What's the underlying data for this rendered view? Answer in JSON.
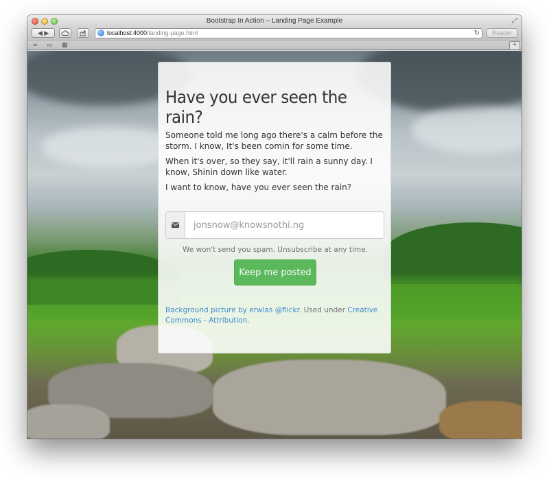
{
  "browser": {
    "window_title": "Bootstrap In Action – Landing Page Example",
    "url_host": "localhost:4000",
    "url_path": "/landing-page.html",
    "reader_label": "Reader",
    "new_tab_label": "+"
  },
  "card": {
    "headline": "Have you ever seen the rain?",
    "paragraphs": [
      "Someone told me long ago there's a calm before the storm. I know, It's been comin for some time.",
      "When it's over, so they say, it'll rain a sunny day. I know, Shinin down like water.",
      "I want to know, have you ever seen the rain?"
    ],
    "email_placeholder": "jonsnow@knowsnothi.ng",
    "help_text": "We won't send you spam. Unsubscribe at any time.",
    "button_label": "Keep me posted",
    "credit": {
      "link1": "Background picture by erwlas @flickr",
      "middle": ". Used under ",
      "link2": "Creative Commons - Attribution",
      "end": "."
    }
  },
  "colors": {
    "button": "#5cb85c",
    "link": "#428bca"
  }
}
